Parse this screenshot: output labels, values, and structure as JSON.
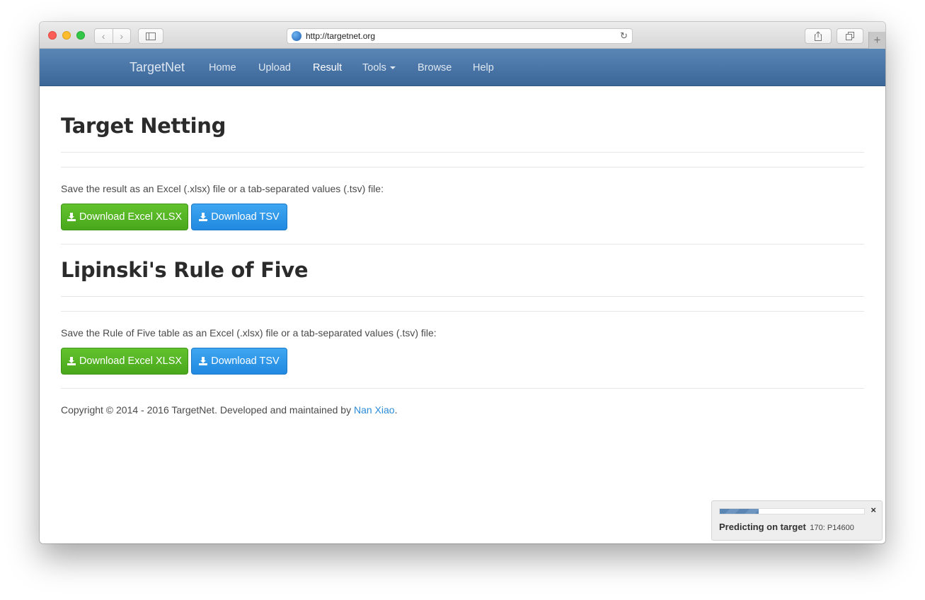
{
  "browser": {
    "url": "http://targetnet.org"
  },
  "navbar": {
    "brand": "TargetNet",
    "items": [
      {
        "label": "Home"
      },
      {
        "label": "Upload"
      },
      {
        "label": "Result",
        "active": true
      },
      {
        "label": "Tools",
        "dropdown": true
      },
      {
        "label": "Browse"
      },
      {
        "label": "Help"
      }
    ]
  },
  "sections": [
    {
      "title": "Target Netting",
      "description": "Save the result as an Excel (.xlsx) file or a tab-separated values (.tsv) file:",
      "buttons": {
        "xlsx": "Download Excel XLSX",
        "tsv": "Download TSV"
      }
    },
    {
      "title": "Lipinski's Rule of Five",
      "description": "Save the Rule of Five table as an Excel (.xlsx) file or a tab-separated values (.tsv) file:",
      "buttons": {
        "xlsx": "Download Excel XLSX",
        "tsv": "Download TSV"
      }
    }
  ],
  "footer": {
    "text": "Copyright © 2014 - 2016 TargetNet. Developed and maintained by ",
    "link": "Nan Xiao",
    "end": "."
  },
  "notification": {
    "progress": 0.27,
    "label": "Predicting on target",
    "detail": "170: P14600",
    "close": "×"
  },
  "icons": {
    "back": "chevron-left-icon",
    "forward": "chevron-right-icon",
    "sidebar": "sidebar-icon",
    "share": "share-icon",
    "tabs": "tabs-icon",
    "reload": "reload-icon",
    "download": "download-icon"
  },
  "colors": {
    "navbar": "#4a76a8",
    "green_button": "#56b521",
    "blue_button": "#2f97e8",
    "link": "#2b8bd8"
  }
}
